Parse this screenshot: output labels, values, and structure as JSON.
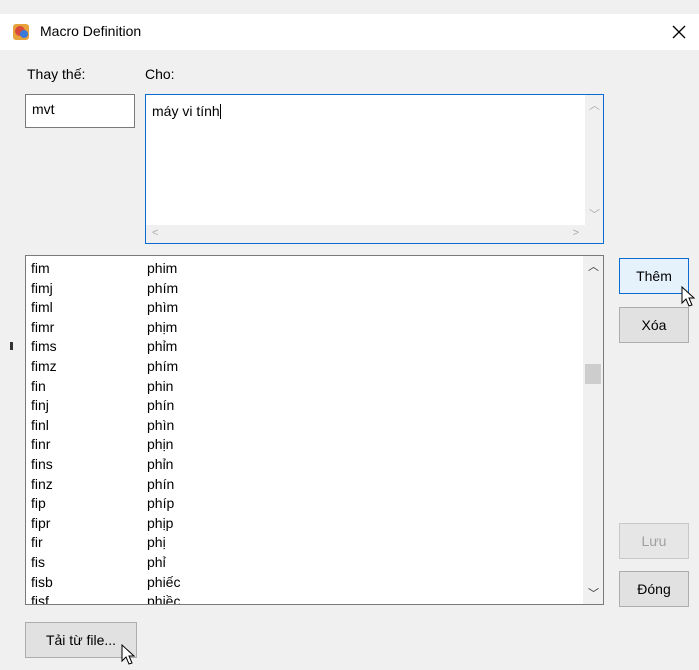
{
  "window": {
    "title": "Macro Definition",
    "close_glyph": "✕"
  },
  "labels": {
    "replace": "Thay thế:",
    "with": "Cho:"
  },
  "inputs": {
    "abbrev_value": "mvt",
    "expansion_value": "máy vi tính"
  },
  "list": {
    "rows": [
      {
        "key": "fim",
        "value": "phim"
      },
      {
        "key": "fimj",
        "value": "phím"
      },
      {
        "key": "fiml",
        "value": "phìm"
      },
      {
        "key": "fimr",
        "value": "phịm"
      },
      {
        "key": "fims",
        "value": "phỉm"
      },
      {
        "key": "fimz",
        "value": "phím"
      },
      {
        "key": "fin",
        "value": "phin"
      },
      {
        "key": "finj",
        "value": "phín"
      },
      {
        "key": "finl",
        "value": "phìn"
      },
      {
        "key": "finr",
        "value": "phịn"
      },
      {
        "key": "fins",
        "value": "phỉn"
      },
      {
        "key": "finz",
        "value": "phín"
      },
      {
        "key": "fip",
        "value": "phíp"
      },
      {
        "key": "fipr",
        "value": "phịp"
      },
      {
        "key": "fir",
        "value": "phị"
      },
      {
        "key": "fis",
        "value": "phỉ"
      },
      {
        "key": "fisb",
        "value": "phiếc"
      },
      {
        "key": "fisf",
        "value": "phiềc"
      }
    ]
  },
  "buttons": {
    "add": "Thêm",
    "delete": "Xóa",
    "save": "Lưu",
    "close": "Đóng",
    "load_file": "Tải từ file..."
  }
}
